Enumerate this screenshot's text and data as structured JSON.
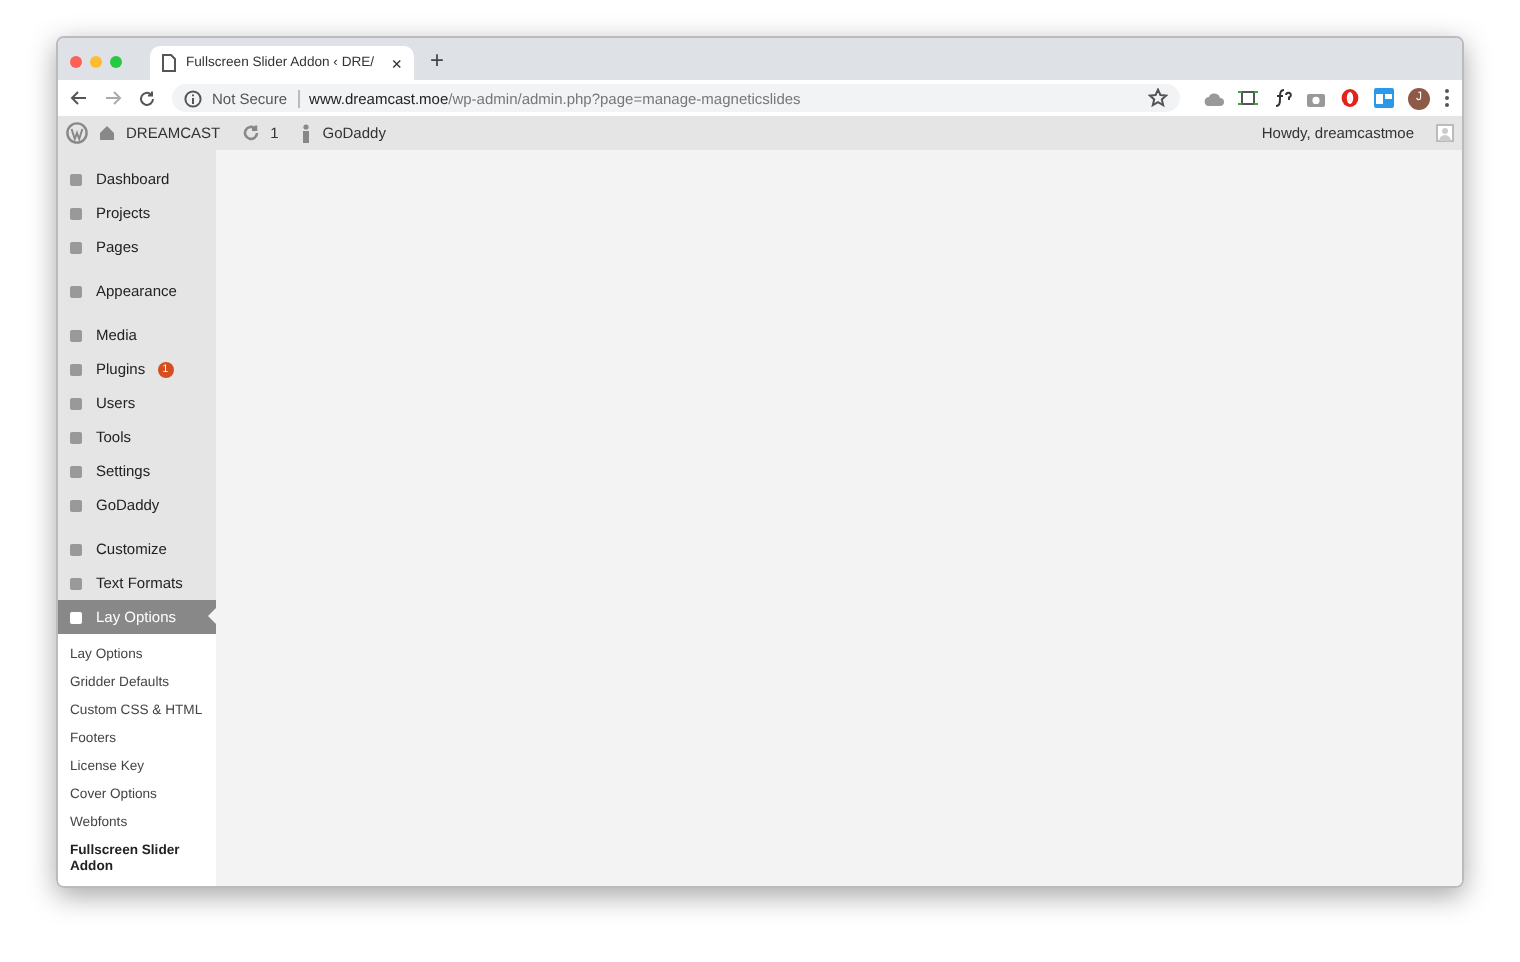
{
  "browser": {
    "tab": {
      "title": "Fullscreen Slider Addon ‹ DRE/",
      "close": "×"
    },
    "new_tab": "+",
    "address": {
      "security": "Not Secure",
      "host": "www.dreamcast.moe",
      "path": "/wp-admin/admin.php?page=manage-magneticslides"
    },
    "avatar_letter": "J"
  },
  "admin_bar": {
    "site": "DREAMCAST",
    "updates": "1",
    "godaddy": "GoDaddy",
    "howdy": "Howdy, dreamcastmoe"
  },
  "sidebar": {
    "groups": [
      [
        {
          "label": "Dashboard",
          "selected": false
        },
        {
          "label": "Projects",
          "selected": false
        },
        {
          "label": "Pages",
          "selected": false
        }
      ],
      [
        {
          "label": "Appearance",
          "selected": false
        }
      ],
      [
        {
          "label": "Media",
          "selected": false
        },
        {
          "label": "Plugins",
          "selected": false,
          "badge": "1"
        },
        {
          "label": "Users",
          "selected": false
        },
        {
          "label": "Tools",
          "selected": false
        },
        {
          "label": "Settings",
          "selected": false
        },
        {
          "label": "GoDaddy",
          "selected": false
        }
      ],
      [
        {
          "label": "Customize",
          "selected": false
        },
        {
          "label": "Text Formats",
          "selected": false
        },
        {
          "label": "Lay Options",
          "selected": true
        }
      ]
    ],
    "submenu": [
      {
        "label": "Lay Options",
        "selected": false
      },
      {
        "label": "Gridder Defaults",
        "selected": false
      },
      {
        "label": "Custom CSS & HTML",
        "selected": false
      },
      {
        "label": "Footers",
        "selected": false
      },
      {
        "label": "License Key",
        "selected": false
      },
      {
        "label": "Cover Options",
        "selected": false
      },
      {
        "label": "Webfonts",
        "selected": false
      },
      {
        "label": "Fullscreen Slider Addon",
        "selected": true
      }
    ]
  }
}
